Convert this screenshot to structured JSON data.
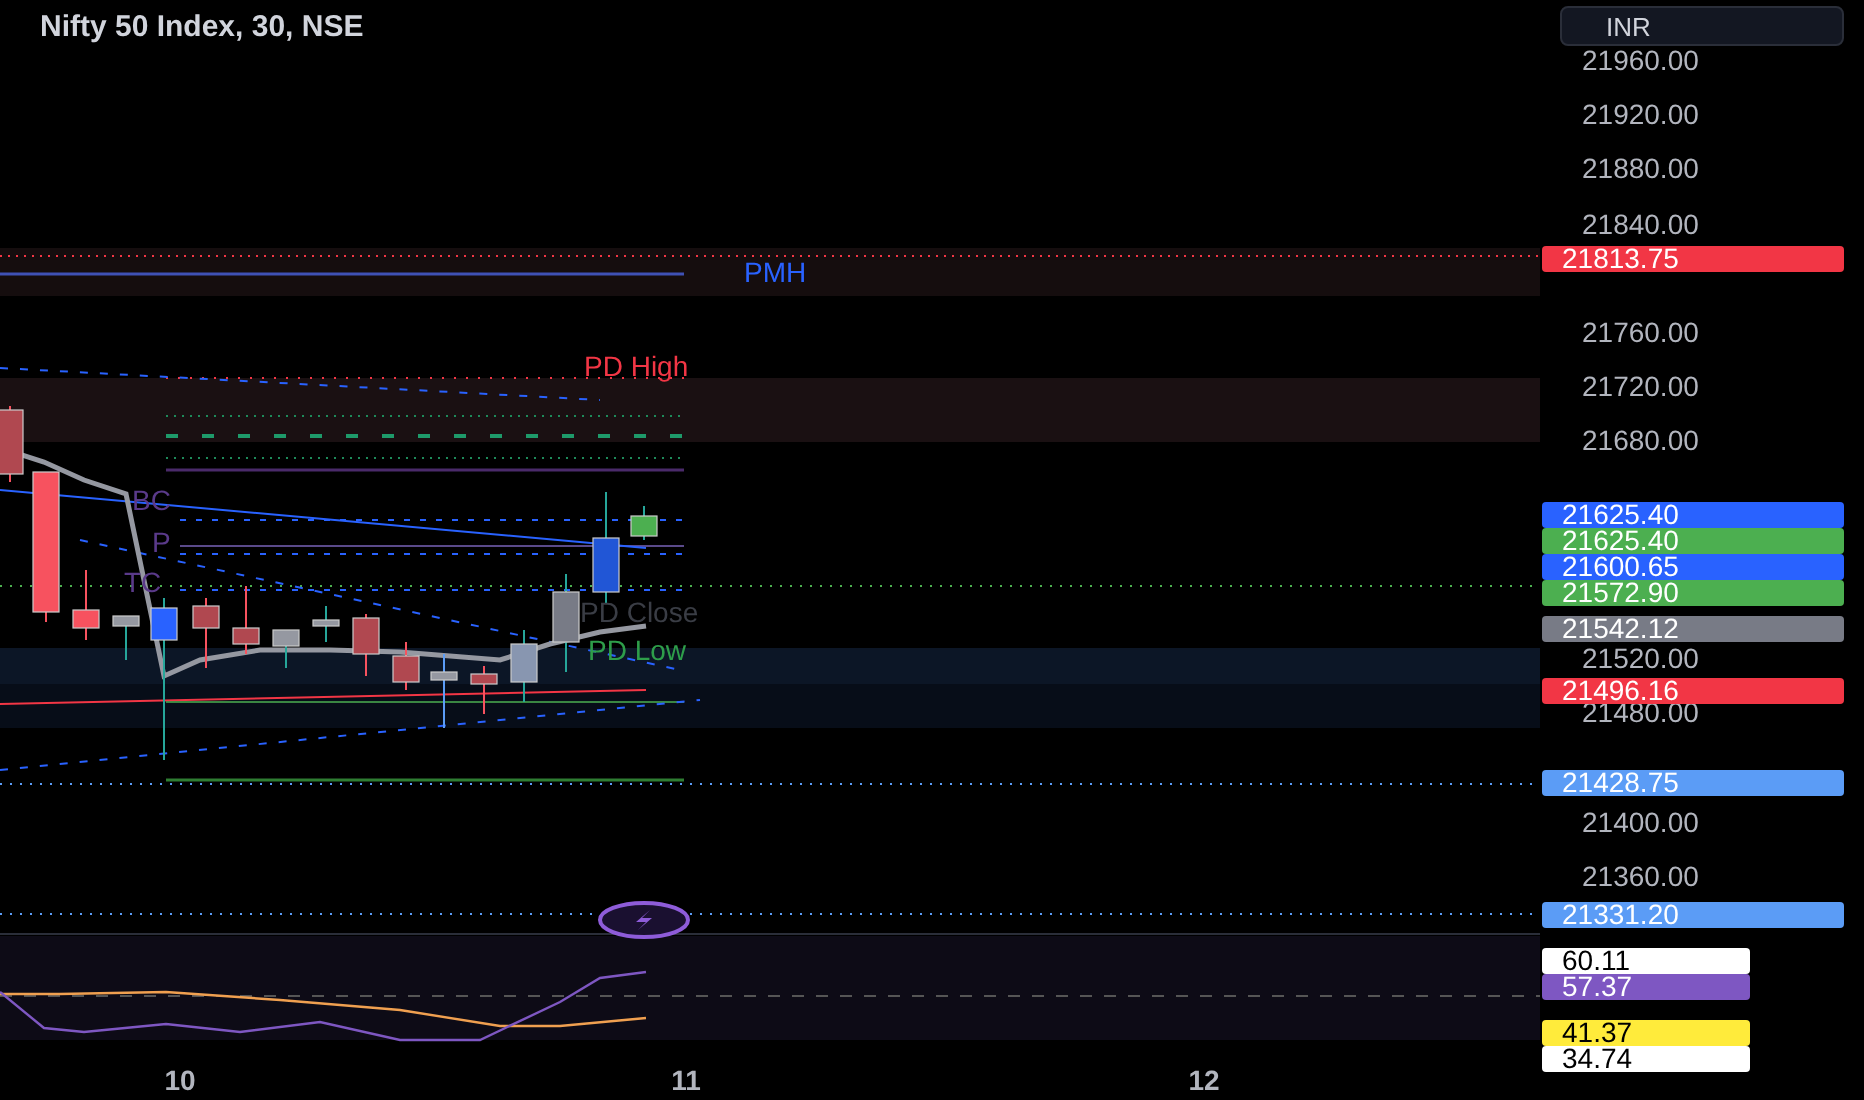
{
  "title": "Nifty 50 Index, 30, NSE",
  "currency_button": "INR",
  "level_labels": [
    {
      "text": "PMH",
      "kind": "pmh"
    },
    {
      "text": "PD High",
      "kind": "pdhigh"
    },
    {
      "text": "BC",
      "kind": "bc"
    },
    {
      "text": "P",
      "kind": "p"
    },
    {
      "text": "TC",
      "kind": "tc"
    },
    {
      "text": "PD Close",
      "kind": "pdclose"
    },
    {
      "text": "PD Low",
      "kind": "pdlow"
    }
  ],
  "price_axis": {
    "ticks": [
      "21960.00",
      "21920.00",
      "21880.00",
      "21840.00",
      "21760.00",
      "21720.00",
      "21680.00",
      "21520.00",
      "21480.00",
      "21400.00",
      "21360.00"
    ],
    "badges": [
      {
        "text": "21813.75",
        "color": "#f23645"
      },
      {
        "text": "21625.40",
        "color": "#2962ff"
      },
      {
        "text": "21625.40",
        "color": "#4caf50"
      },
      {
        "text": "21600.65",
        "color": "#2962ff"
      },
      {
        "text": "21572.90",
        "color": "#4caf50"
      },
      {
        "text": "21542.12",
        "color": "#787b86"
      },
      {
        "text": "21496.16",
        "color": "#f23645"
      },
      {
        "text": "21428.75",
        "color": "#5b9cf6"
      },
      {
        "text": "21331.20",
        "color": "#5b9cf6"
      }
    ]
  },
  "oscillator_badges": [
    {
      "text": "60.11",
      "color": "#ffffff"
    },
    {
      "text": "57.37",
      "color": "#7e57c2"
    },
    {
      "text": "41.37",
      "color": "#ffeb3b"
    },
    {
      "text": "34.74",
      "color": "#ffffff"
    }
  ],
  "time_axis": [
    "10",
    "11",
    "12"
  ]
}
